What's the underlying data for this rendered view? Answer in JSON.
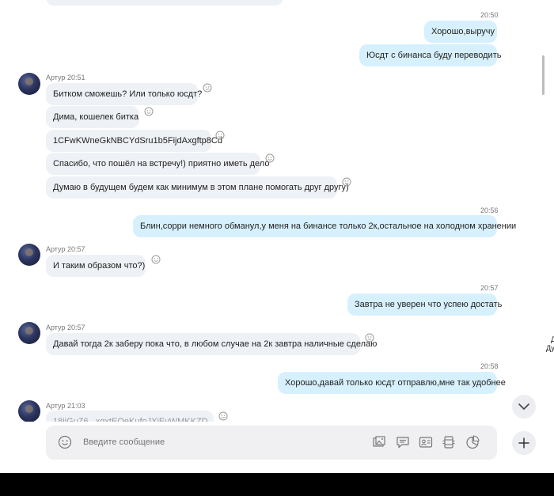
{
  "messages": {
    "t1": "20:50",
    "o1": "Хорошо,выручу",
    "o2": "Юсдт с бинанса буду переводить",
    "s1": "Артур 20:51",
    "i1": "Битком сможешь? Или только юсдт?",
    "i2": "Дима, кошелек битка",
    "i3": "1CFwKWneGkNBCYdSru1b5FijdAxgftp8Cd",
    "i4": "Спасибо, что пошёл на встречу!) приятно иметь дело",
    "i5": "Думаю в будущем будем как минимум в этом плане помогать друг другу)",
    "t2": "20:56",
    "o3": "Блин,сорри немного обманул,у меня на бинансе только 2к,остальное на холодном хранении",
    "s2": "Артур 20:57",
    "i6": "И таким образом что?)",
    "t3": "20:57",
    "o4": "Завтра не уверен что успею достать",
    "s3": "Артур 20:57",
    "i7": "Давай тогда 2к заберу пока что, в любом случае на 2к завтра наличные сделаю",
    "t4": "20:58",
    "o5": "Хорошо,давай только юсдт отправлю,мне так удобнее",
    "s4": "Артур 21:03",
    "i8": "18jjGuZ6...xgxtEQeKufoJXiEvWMKKZD"
  },
  "composer": {
    "placeholder": "Введите сообщение"
  },
  "edge": {
    "label1": "Д",
    "label2": "Ду"
  },
  "icons": {
    "emoji": "smiley-icon",
    "gallery": "gallery-icon",
    "chat": "chat-bubble-icon",
    "contact": "contact-card-icon",
    "file": "file-icon",
    "poll": "pie-chart-icon",
    "scroll": "chevron-down-icon",
    "plus": "plus-icon"
  },
  "colors": {
    "incoming": "#eef1f6",
    "outgoing": "#d7f0fd",
    "composer": "#f0f0f2"
  }
}
